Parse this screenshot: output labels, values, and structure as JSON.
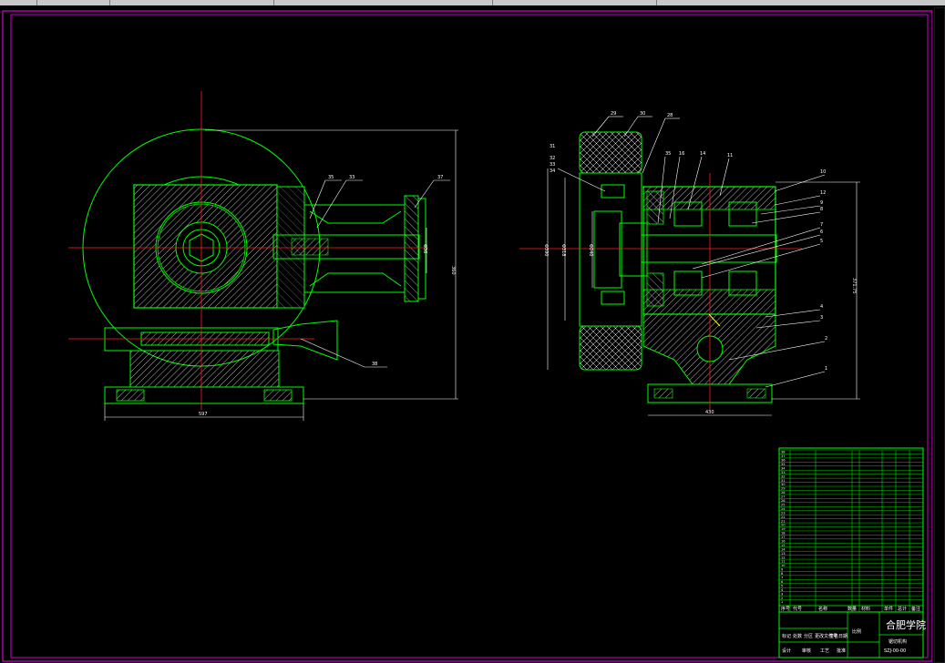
{
  "drawing": {
    "colors": {
      "background": "#000000",
      "outline": "#00ff00",
      "hatch": "#ffffff",
      "centerline": "#ff2020",
      "dimension": "#ffffff",
      "leader": "#ffffff",
      "magenta_border": "#ff00ff",
      "yellow": "#ffff00",
      "cyan": "#00ffff"
    },
    "left_view": {
      "overall_width_dim": "597",
      "overall_height_dim": "360",
      "callout_upper_left": "35",
      "callout_upper_right": "33",
      "callout_far_right": "37",
      "callout_bottom": "38",
      "shaft_dim": "Φ36"
    },
    "right_view": {
      "base_width_dim": "430",
      "right_height_dim": "371.75",
      "left_dims": [
        "Φ390",
        "Φ318",
        "Φ240"
      ],
      "callouts_top": [
        "29",
        "30",
        "28",
        "35",
        "16",
        "14",
        "11",
        "10"
      ],
      "callouts_left": [
        "31",
        "32",
        "33",
        "34"
      ],
      "callouts_right": [
        "12",
        "9",
        "8",
        "7",
        "6",
        "5",
        "4",
        "3",
        "2",
        "1"
      ]
    }
  },
  "title_block": {
    "school": "合肥学院",
    "drawing_title": "锯切机构",
    "scale_label": "比例",
    "drawing_no": "SZJ-00-00",
    "bottom_labels": [
      "标记",
      "处数",
      "分区",
      "更改文件号",
      "签名",
      "日期"
    ],
    "footer": [
      "设计",
      "审核",
      "工艺",
      "批准"
    ],
    "header_columns": [
      "序号",
      "代号",
      "名称",
      "数量",
      "材料",
      "单件",
      "总计",
      "备注"
    ],
    "parts_rows": [
      "38",
      "37",
      "36",
      "35",
      "34",
      "33",
      "32",
      "31",
      "30",
      "29",
      "28",
      "27",
      "26",
      "25",
      "24",
      "23",
      "22",
      "21",
      "20",
      "19",
      "18",
      "17",
      "16",
      "15",
      "14",
      "13",
      "12",
      "11",
      "10",
      "9",
      "8",
      "7",
      "6",
      "5",
      "4",
      "3",
      "2",
      "1"
    ]
  }
}
